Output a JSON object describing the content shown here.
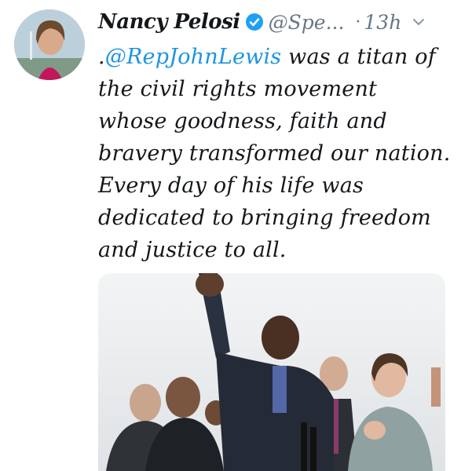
{
  "author": {
    "name": "Nancy Pelosi",
    "handle": "@Spe...",
    "time": "13h",
    "separator": "·"
  },
  "tweet": {
    "lead": ".",
    "mention": "@RepJohnLewis",
    "text": " was a titan of the civil rights movement whose goodness, faith and bravery transformed our nation. Every day of his life was dedicated to bringing freedom and justice to all."
  },
  "icons": {
    "verified": "verified-badge-icon",
    "menu": "chevron-down-icon"
  },
  "colors": {
    "link": "#1b95e0",
    "verified": "#1da1f2",
    "secondary_text": "#657786"
  }
}
